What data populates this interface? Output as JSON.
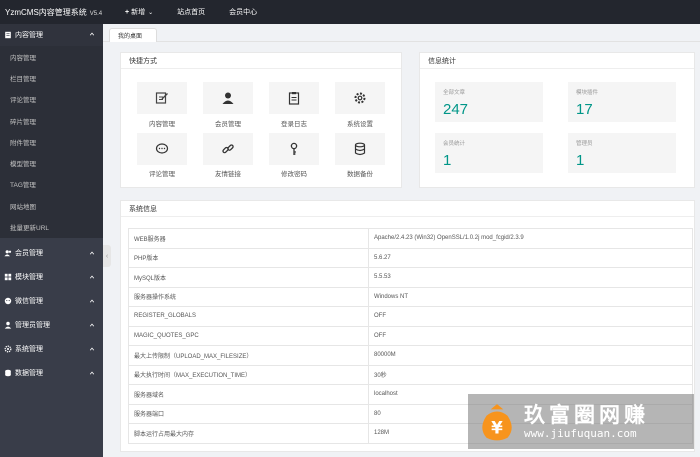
{
  "brand": {
    "name": "YzmCMS内容管理系统",
    "version": "V5.4"
  },
  "topnav": [
    {
      "label": "新增"
    },
    {
      "label": "站点首页"
    },
    {
      "label": "会员中心"
    }
  ],
  "sidebar": {
    "groups": [
      {
        "label": "内容管理",
        "items": [
          "内容管理",
          "栏目管理",
          "评论管理",
          "碎片管理",
          "附件管理",
          "模型管理",
          "TAG管理",
          "网站地图",
          "批量更新URL"
        ]
      },
      {
        "label": "会员管理"
      },
      {
        "label": "模块管理"
      },
      {
        "label": "微信管理"
      },
      {
        "label": "管理员管理"
      },
      {
        "label": "系统管理"
      },
      {
        "label": "数据管理"
      }
    ]
  },
  "tabs": [
    {
      "label": "我的桌面"
    }
  ],
  "shortcuts": {
    "title": "快捷方式",
    "items": [
      {
        "label": "内容管理",
        "icon": "edit-icon"
      },
      {
        "label": "会员管理",
        "icon": "user-icon"
      },
      {
        "label": "登录日志",
        "icon": "clipboard-icon"
      },
      {
        "label": "系统设置",
        "icon": "gear-icon"
      },
      {
        "label": "评论管理",
        "icon": "comment-icon"
      },
      {
        "label": "友情链接",
        "icon": "link-icon"
      },
      {
        "label": "修改密码",
        "icon": "key-icon"
      },
      {
        "label": "数据备份",
        "icon": "database-icon"
      }
    ]
  },
  "stats": {
    "title": "信息统计",
    "items": [
      {
        "label": "全部文章",
        "value": "247"
      },
      {
        "label": "模块插件",
        "value": "17"
      },
      {
        "label": "会员统计",
        "value": "1"
      },
      {
        "label": "管理员",
        "value": "1"
      }
    ]
  },
  "sysinfo": {
    "title": "系统信息",
    "rows": [
      {
        "key": "WEB服务器",
        "value": "Apache/2.4.23 (Win32) OpenSSL/1.0.2j mod_fcgid/2.3.9"
      },
      {
        "key": "PHP版本",
        "value": "5.6.27"
      },
      {
        "key": "MySQL版本",
        "value": "5.5.53"
      },
      {
        "key": "服务器操作系统",
        "value": "Windows NT"
      },
      {
        "key": "REGISTER_GLOBALS",
        "value": "OFF"
      },
      {
        "key": "MAGIC_QUOTES_GPC",
        "value": "OFF"
      },
      {
        "key": "最大上传限制（UPLOAD_MAX_FILESIZE）",
        "value": "80000M"
      },
      {
        "key": "最大执行时间（MAX_EXECUTION_TIME）",
        "value": "30秒"
      },
      {
        "key": "服务器域名",
        "value": "localhost"
      },
      {
        "key": "服务器端口",
        "value": "80"
      },
      {
        "key": "脚本运行占用最大内存",
        "value": "128M"
      }
    ]
  },
  "watermark": {
    "text": "玖富圈网赚",
    "url": "www.jiufuquan.com"
  },
  "colors": {
    "accent": "#009688",
    "sidebar": "#393d49",
    "topbar": "#23262e"
  }
}
